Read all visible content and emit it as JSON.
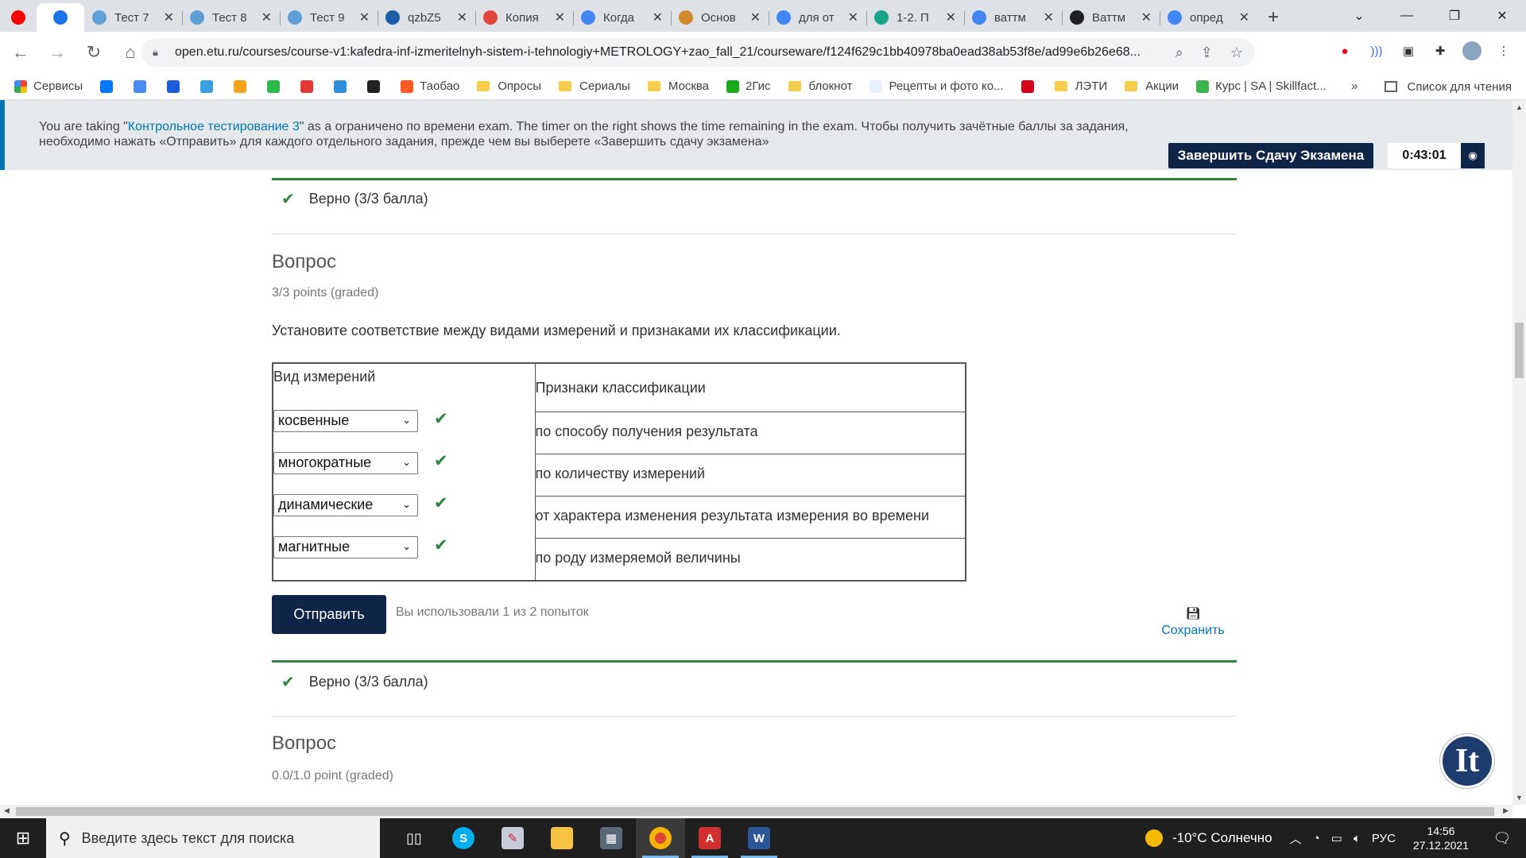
{
  "browser": {
    "tabs": [
      {
        "title": "",
        "icon": "youtube-icon",
        "color": "#ff0000"
      },
      {
        "title": "",
        "icon": "edge-icon",
        "color": "#1a73e8",
        "active": true
      },
      {
        "title": "Тест 7",
        "icon": "loading-icon",
        "color": "#5f9fd6"
      },
      {
        "title": "Тест 8",
        "icon": "loading-icon",
        "color": "#5f9fd6"
      },
      {
        "title": "Тест 9",
        "icon": "loading-icon",
        "color": "#5f9fd6"
      },
      {
        "title": "qzbZ5",
        "icon": "s-icon",
        "color": "#1b5fa8"
      },
      {
        "title": "Копия",
        "icon": "slides-icon",
        "color": "#e0463a"
      },
      {
        "title": "Когда",
        "icon": "google-icon",
        "color": "#4285f4"
      },
      {
        "title": "Основ",
        "icon": "studfiles-icon",
        "color": "#d28b2b"
      },
      {
        "title": "для от",
        "icon": "google-icon",
        "color": "#4285f4"
      },
      {
        "title": "1-2. П",
        "icon": "pi-icon",
        "color": "#17a589"
      },
      {
        "title": "ваттм",
        "icon": "google-icon",
        "color": "#4285f4"
      },
      {
        "title": "Ваттм",
        "icon": "wikipedia-icon",
        "color": "#202124"
      },
      {
        "title": "опред",
        "icon": "google-icon",
        "color": "#4285f4"
      }
    ],
    "url": "open.etu.ru/courses/course-v1:kafedra-inf-izmeritelnyh-sistem-i-tehnologiy+METROLOGY+zao_fall_21/courseware/f124f629c1bb40978ba0ead38ab53f8e/ad99e6b26e68...",
    "bookmarks": [
      {
        "label": "Сервисы",
        "kind": "apps"
      },
      {
        "label": "",
        "kind": "icon",
        "color": "#0077ff"
      },
      {
        "label": "",
        "kind": "icon",
        "color": "#4a8af4"
      },
      {
        "label": "",
        "kind": "icon",
        "color": "#1e5bd8"
      },
      {
        "label": "",
        "kind": "icon",
        "color": "#3aa0e0"
      },
      {
        "label": "",
        "kind": "icon",
        "color": "#f3a21b"
      },
      {
        "label": "",
        "kind": "icon",
        "color": "#2cb84b"
      },
      {
        "label": "",
        "kind": "icon",
        "color": "#e53935"
      },
      {
        "label": "",
        "kind": "icon",
        "color": "#2f8ed8"
      },
      {
        "label": "",
        "kind": "icon",
        "color": "#222222"
      },
      {
        "label": "Таобао",
        "kind": "icon",
        "color": "#ff5722"
      },
      {
        "label": "Опросы",
        "kind": "folder"
      },
      {
        "label": "Сериалы",
        "kind": "folder"
      },
      {
        "label": "Москва",
        "kind": "folder"
      },
      {
        "label": "2Гис",
        "kind": "icon",
        "color": "#19aa1e"
      },
      {
        "label": "блокнот",
        "kind": "folder"
      },
      {
        "label": "Рецепты и фото ко...",
        "kind": "icon",
        "color": "#e8f0fe"
      },
      {
        "label": "",
        "kind": "icon",
        "color": "#d6001c"
      },
      {
        "label": "ЛЭТИ",
        "kind": "folder"
      },
      {
        "label": "Акции",
        "kind": "folder"
      },
      {
        "label": "Курс | SA | Skillfact...",
        "kind": "icon",
        "color": "#3cb54a"
      }
    ],
    "bookmarks_more": "»",
    "reading_list": "Список для чтения"
  },
  "banner": {
    "prefix": "You are taking \"",
    "exam_link": "Контрольное тестирование 3",
    "suffix": "\" as a ограничено по времени exam. The timer on the right shows the time remaining in the exam. Чтобы получить зачётные баллы за задания, необходимо нажать «Отправить» для каждого отдельного задания, прежде чем вы выберете «Завершить сдачу экзамена»",
    "end_button": "Завершить Сдачу Экзамена",
    "timer": "0:43:01"
  },
  "prev_status": "Верно (3/3 балла)",
  "question": {
    "title": "Вопрос",
    "points": "3/3 points (graded)",
    "text": "Установите соответствие между видами измерений и признаками их классификации.",
    "header_left": "Вид измерений",
    "header_right": "Признаки классификации",
    "rows": [
      {
        "selected": "косвенные",
        "criterion": "по способу получения результата"
      },
      {
        "selected": "многократные",
        "criterion": "по количеству измерений"
      },
      {
        "selected": "динамические",
        "criterion": "от характера изменения результата измерения во времени"
      },
      {
        "selected": "магнитные",
        "criterion": "по роду измеряемой величины"
      }
    ],
    "submit": "Отправить",
    "attempts": "Вы использовали 1 из 2 попыток",
    "save": "Сохранить",
    "status": "Верно (3/3 балла)"
  },
  "next_question": {
    "title": "Вопрос",
    "points": "0.0/1.0 point (graded)"
  },
  "widget": {
    "label": "It"
  },
  "taskbar": {
    "search_placeholder": "Введите здесь текст для поиска",
    "weather": "-10°C Солнечно",
    "lang": "РУС",
    "time": "14:56",
    "date": "27.12.2021"
  }
}
